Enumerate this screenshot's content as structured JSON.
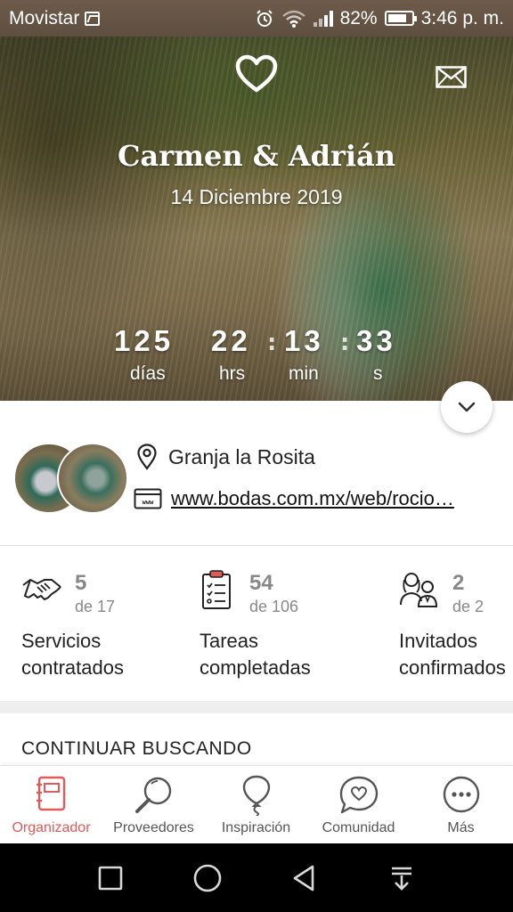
{
  "status_bar": {
    "carrier": "Movistar",
    "battery": "82%",
    "battery_level": 0.82,
    "time": "3:46 p. m."
  },
  "hero": {
    "couple_names": "Carmen & Adrián",
    "date": "14 Diciembre 2019",
    "countdown": [
      {
        "value": "125",
        "unit": "días"
      },
      {
        "value": "22",
        "unit": "hrs"
      },
      {
        "value": "13",
        "unit": "min"
      },
      {
        "value": "33",
        "unit": "s"
      }
    ]
  },
  "info": {
    "location": "Granja la Rosita",
    "website": "www.bodas.com.mx/web/rocio…"
  },
  "stats": [
    {
      "count": "5",
      "of": "de 17",
      "label_line1": "Servicios",
      "label_line2": "contratados",
      "icon": "handshake-icon"
    },
    {
      "count": "54",
      "of": "de 106",
      "label_line1": "Tareas",
      "label_line2": "completadas",
      "icon": "checklist-icon"
    },
    {
      "count": "2",
      "of": "de 2",
      "label_line1": "Invitados",
      "label_line2": "confirmados",
      "icon": "guests-icon"
    }
  ],
  "section_title": "CONTINUAR BUSCANDO",
  "bottom_nav": [
    {
      "label": "Organizador",
      "icon": "notebook-icon",
      "active": true
    },
    {
      "label": "Proveedores",
      "icon": "magnifier-icon",
      "active": false
    },
    {
      "label": "Inspiración",
      "icon": "balloon-icon",
      "active": false
    },
    {
      "label": "Comunidad",
      "icon": "chat-heart-icon",
      "active": false
    },
    {
      "label": "Más",
      "icon": "more-icon",
      "active": false
    }
  ],
  "colors": {
    "accent": "#e05a5a",
    "stat_gray": "#888888",
    "status_bar": "#6d5a4a"
  }
}
